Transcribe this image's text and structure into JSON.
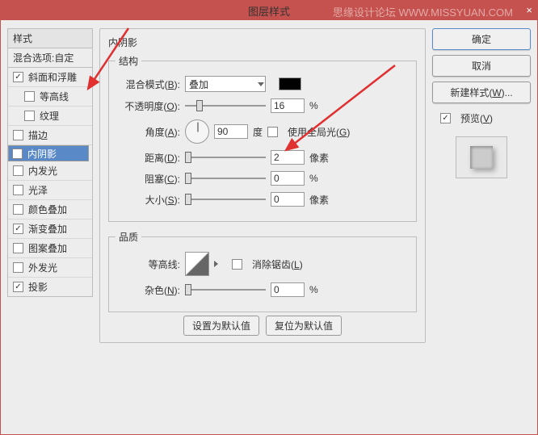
{
  "title": "图层样式",
  "watermark": "思缘设计论坛  WWW.MISSYUAN.COM",
  "close": "×",
  "left": {
    "header": "样式",
    "sub": "混合选项:自定",
    "items": [
      {
        "label": "斜面和浮雕",
        "checked": true,
        "indent": false
      },
      {
        "label": "等高线",
        "checked": false,
        "indent": true
      },
      {
        "label": "纹理",
        "checked": false,
        "indent": true
      },
      {
        "label": "描边",
        "checked": false,
        "indent": false
      },
      {
        "label": "内阴影",
        "checked": true,
        "indent": false,
        "selected": true
      },
      {
        "label": "内发光",
        "checked": false,
        "indent": false
      },
      {
        "label": "光泽",
        "checked": false,
        "indent": false
      },
      {
        "label": "颜色叠加",
        "checked": false,
        "indent": false
      },
      {
        "label": "渐变叠加",
        "checked": true,
        "indent": false
      },
      {
        "label": "图案叠加",
        "checked": false,
        "indent": false
      },
      {
        "label": "外发光",
        "checked": false,
        "indent": false
      },
      {
        "label": "投影",
        "checked": true,
        "indent": false
      }
    ]
  },
  "mid": {
    "heading": "内阴影",
    "struct": "结构",
    "blend_lbl": "混合模式(B):",
    "blend_val": "叠加",
    "opacity_lbl": "不透明度(O):",
    "opacity_val": "16",
    "pct": "%",
    "angle_lbl": "角度(A):",
    "angle_val": "90",
    "deg": "度",
    "global": "使用全局光(G)",
    "dist_lbl": "距离(D):",
    "dist_val": "2",
    "px": "像素",
    "choke_lbl": "阻塞(C):",
    "choke_val": "0",
    "size_lbl": "大小(S):",
    "size_val": "0",
    "quality": "品质",
    "contour_lbl": "等高线:",
    "anti": "消除锯齿(L)",
    "noise_lbl": "杂色(N):",
    "noise_val": "0",
    "btn_default": "设置为默认值",
    "btn_reset": "复位为默认值"
  },
  "right": {
    "ok": "确定",
    "cancel": "取消",
    "newstyle": "新建样式(W)...",
    "preview": "预览(V)"
  }
}
